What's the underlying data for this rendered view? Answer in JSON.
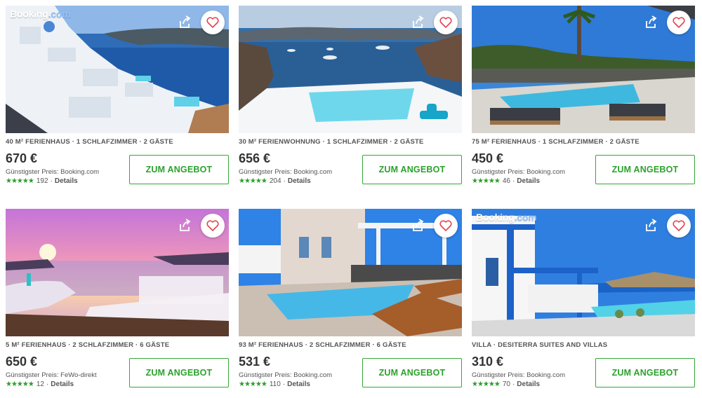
{
  "cards": [
    {
      "brand_main": "Booking",
      "brand_suffix": ".com",
      "meta": "40 M² FERIENHAUS · 1 SCHLAFZIMMER · 2 GÄSTE",
      "price": "670 €",
      "cheapest": "Günstigster Preis: Booking.com",
      "reviews": "192",
      "details": "Details",
      "cta": "ZUM ANGEBOT"
    },
    {
      "brand_main": "",
      "brand_suffix": "",
      "meta": "30 M² FERIENWOHNUNG · 1 SCHLAFZIMMER · 2 GÄSTE",
      "price": "656 €",
      "cheapest": "Günstigster Preis: Booking.com",
      "reviews": "204",
      "details": "Details",
      "cta": "ZUM ANGEBOT"
    },
    {
      "brand_main": "",
      "brand_suffix": "",
      "meta": "75 M² FERIENHAUS · 1 SCHLAFZIMMER · 2 GÄSTE",
      "price": "450 €",
      "cheapest": "Günstigster Preis: Booking.com",
      "reviews": "46",
      "details": "Details",
      "cta": "ZUM ANGEBOT"
    },
    {
      "brand_main": "",
      "brand_suffix": "",
      "meta": "5 M² FERIENHAUS · 2 SCHLAFZIMMER · 6 GÄSTE",
      "price": "650 €",
      "cheapest": "Günstigster Preis: FeWo-direkt",
      "reviews": "12",
      "details": "Details",
      "cta": "ZUM ANGEBOT"
    },
    {
      "brand_main": "",
      "brand_suffix": "",
      "meta": "93 M² FERIENHAUS · 2 SCHLAFZIMMER · 6 GÄSTE",
      "price": "531 €",
      "cheapest": "Günstigster Preis: Booking.com",
      "reviews": "110",
      "details": "Details",
      "cta": "ZUM ANGEBOT"
    },
    {
      "brand_main": "Booking",
      "brand_suffix": ".com",
      "meta": "VILLA · DESITERRA SUITES AND VILLAS",
      "price": "310 €",
      "cheapest": "Günstigster Preis: Booking.com",
      "reviews": "70",
      "details": "Details",
      "cta": "ZUM ANGEBOT"
    }
  ],
  "icons": {
    "share": "share-icon",
    "favorite": "heart-icon",
    "rating": "star-icon"
  },
  "colors": {
    "cta_green": "#2aa22a",
    "star_green": "#2a9d2a",
    "heart_red": "#e2454d"
  }
}
